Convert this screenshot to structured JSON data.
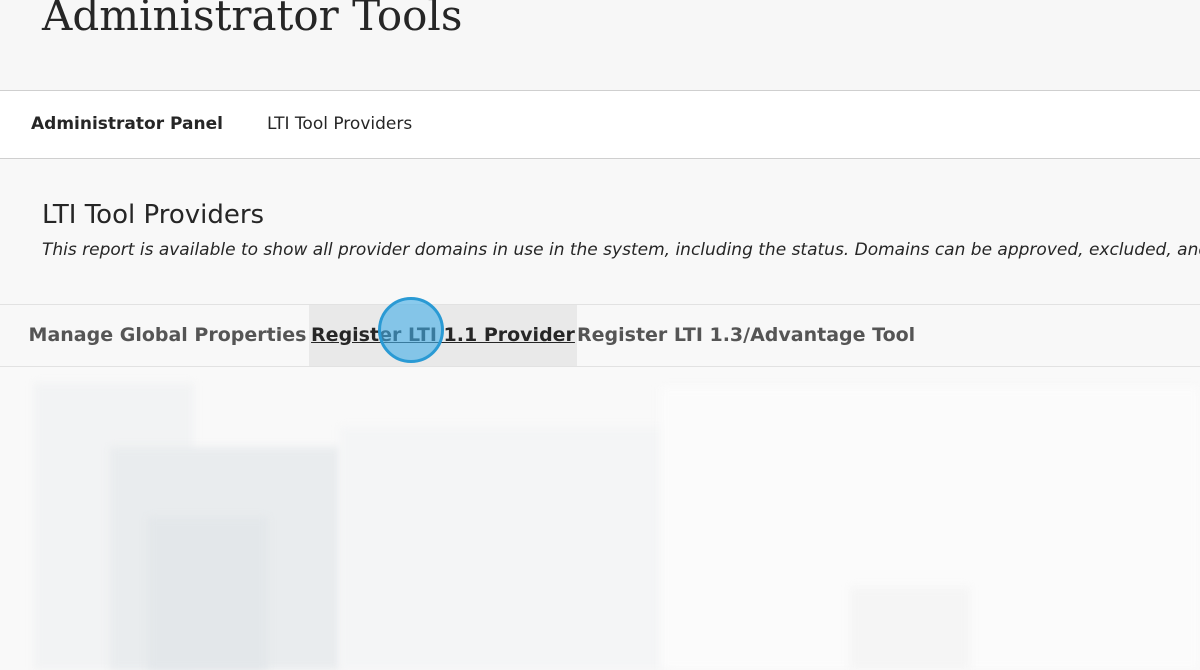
{
  "header": {
    "title": "Administrator Tools"
  },
  "breadcrumb": {
    "items": [
      {
        "label": "Administrator Panel"
      },
      {
        "label": "LTI Tool Providers"
      }
    ]
  },
  "section": {
    "title": "LTI Tool Providers",
    "description": "This report is available to show all provider domains in use in the system, including the status. Domains can be approved, excluded, and deleted. Use"
  },
  "action_bar": {
    "items": [
      {
        "label": "Manage Global Properties"
      },
      {
        "label": "Register LTI 1.1 Provider"
      },
      {
        "label": "Register LTI 1.3/Advantage Tool"
      }
    ]
  },
  "colors": {
    "page_background": "#f8f8f8",
    "text": "#262626",
    "action_text": "#555555",
    "click_marker": "#2a9ad4"
  }
}
